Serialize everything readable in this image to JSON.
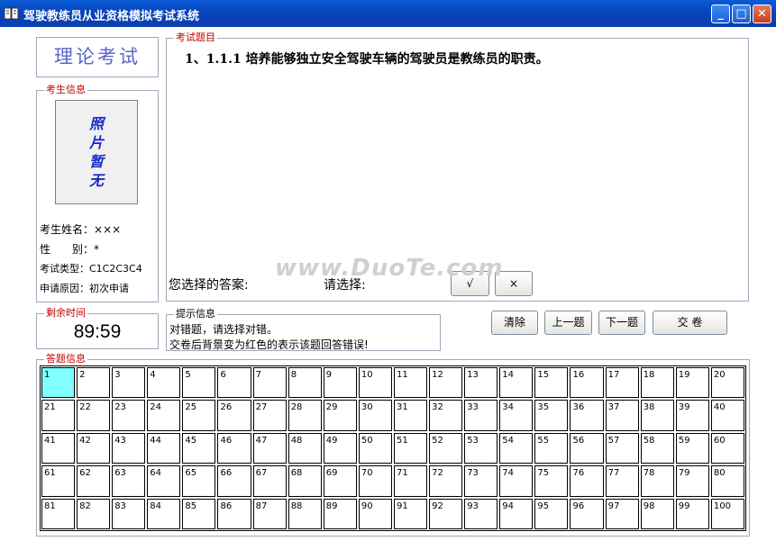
{
  "window": {
    "title": "驾驶教练员从业资格模拟考试系统",
    "minimize": "_",
    "maximize": "□",
    "close": "✕"
  },
  "exam_type_banner": "理论考试",
  "candidate": {
    "legend": "考生信息",
    "photo_text": "照片暂无",
    "name_label": "考生姓名：",
    "name_value": "×××",
    "gender_label": "性　　别：",
    "gender_value": "*",
    "type_label": "考试类型：",
    "type_value": "C1C2C3C4",
    "reason_label": "申请原因：",
    "reason_value": "初次申请"
  },
  "timer": {
    "legend": "剩余时间",
    "value": "89:59"
  },
  "question": {
    "legend": "考试题目",
    "text": "1、1.1.1 培养能够独立安全驾驶车辆的驾驶员是教练员的职责。",
    "answer_label": "您选择的答案:",
    "answer_value": "",
    "choose_label": "请选择:",
    "btn_true": "√",
    "btn_false": "×"
  },
  "hint": {
    "legend": "提示信息",
    "line1": "对错题，请选择对错。",
    "line2": "交卷后背景变为红色的表示该题回答错误!"
  },
  "actions": {
    "clear": "清除",
    "prev": "上一题",
    "next": "下一题",
    "submit": "交 卷"
  },
  "answer_grid": {
    "legend": "答题信息",
    "current": 1,
    "cells": [
      "1",
      "2",
      "3",
      "4",
      "5",
      "6",
      "7",
      "8",
      "9",
      "10",
      "11",
      "12",
      "13",
      "14",
      "15",
      "16",
      "17",
      "18",
      "19",
      "20",
      "21",
      "22",
      "23",
      "24",
      "25",
      "26",
      "27",
      "28",
      "29",
      "30",
      "31",
      "32",
      "33",
      "34",
      "35",
      "36",
      "37",
      "38",
      "39",
      "40",
      "41",
      "42",
      "43",
      "44",
      "45",
      "46",
      "47",
      "48",
      "49",
      "50",
      "51",
      "52",
      "53",
      "54",
      "55",
      "56",
      "57",
      "58",
      "59",
      "60",
      "61",
      "62",
      "63",
      "64",
      "65",
      "66",
      "67",
      "68",
      "69",
      "70",
      "71",
      "72",
      "73",
      "74",
      "75",
      "76",
      "77",
      "78",
      "79",
      "80",
      "81",
      "82",
      "83",
      "84",
      "85",
      "86",
      "87",
      "88",
      "89",
      "90",
      "91",
      "92",
      "93",
      "94",
      "95",
      "96",
      "97",
      "98",
      "99",
      "100"
    ]
  },
  "watermark": "www.DuoTe.com",
  "colors": {
    "titlebar": "#0A5BD8",
    "legend_red": "#C00000",
    "current_cell": "#7FFFFF",
    "banner_text": "#5A64C8",
    "photo_text": "#1A2AC8"
  }
}
